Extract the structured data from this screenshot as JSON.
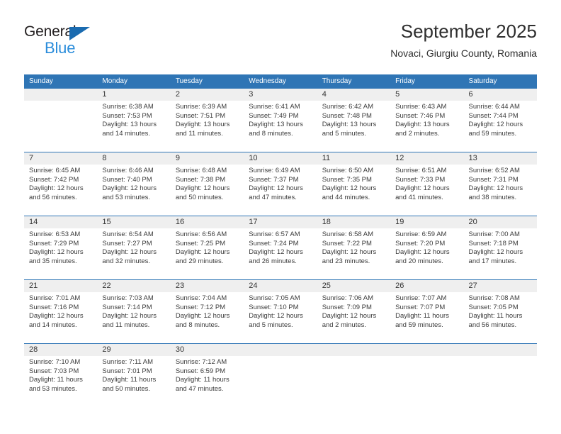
{
  "brand": {
    "name_part1": "General",
    "name_part2": "Blue",
    "colors": {
      "dark": "#231f20",
      "blue": "#2b8ddb",
      "triangle": "#1a6bb0"
    }
  },
  "header": {
    "title": "September 2025",
    "subtitle": "Novaci, Giurgiu County, Romania"
  },
  "theme": {
    "header_bg": "#2f75b5",
    "daynum_bg": "#efefef",
    "text": "#3b3b3b"
  },
  "weekdays": [
    "Sunday",
    "Monday",
    "Tuesday",
    "Wednesday",
    "Thursday",
    "Friday",
    "Saturday"
  ],
  "weeks": [
    {
      "days": [
        {
          "num": "",
          "lines": [
            "",
            "",
            "",
            ""
          ]
        },
        {
          "num": "1",
          "lines": [
            "Sunrise: 6:38 AM",
            "Sunset: 7:53 PM",
            "Daylight: 13 hours",
            "and 14 minutes."
          ]
        },
        {
          "num": "2",
          "lines": [
            "Sunrise: 6:39 AM",
            "Sunset: 7:51 PM",
            "Daylight: 13 hours",
            "and 11 minutes."
          ]
        },
        {
          "num": "3",
          "lines": [
            "Sunrise: 6:41 AM",
            "Sunset: 7:49 PM",
            "Daylight: 13 hours",
            "and 8 minutes."
          ]
        },
        {
          "num": "4",
          "lines": [
            "Sunrise: 6:42 AM",
            "Sunset: 7:48 PM",
            "Daylight: 13 hours",
            "and 5 minutes."
          ]
        },
        {
          "num": "5",
          "lines": [
            "Sunrise: 6:43 AM",
            "Sunset: 7:46 PM",
            "Daylight: 13 hours",
            "and 2 minutes."
          ]
        },
        {
          "num": "6",
          "lines": [
            "Sunrise: 6:44 AM",
            "Sunset: 7:44 PM",
            "Daylight: 12 hours",
            "and 59 minutes."
          ]
        }
      ]
    },
    {
      "days": [
        {
          "num": "7",
          "lines": [
            "Sunrise: 6:45 AM",
            "Sunset: 7:42 PM",
            "Daylight: 12 hours",
            "and 56 minutes."
          ]
        },
        {
          "num": "8",
          "lines": [
            "Sunrise: 6:46 AM",
            "Sunset: 7:40 PM",
            "Daylight: 12 hours",
            "and 53 minutes."
          ]
        },
        {
          "num": "9",
          "lines": [
            "Sunrise: 6:48 AM",
            "Sunset: 7:38 PM",
            "Daylight: 12 hours",
            "and 50 minutes."
          ]
        },
        {
          "num": "10",
          "lines": [
            "Sunrise: 6:49 AM",
            "Sunset: 7:37 PM",
            "Daylight: 12 hours",
            "and 47 minutes."
          ]
        },
        {
          "num": "11",
          "lines": [
            "Sunrise: 6:50 AM",
            "Sunset: 7:35 PM",
            "Daylight: 12 hours",
            "and 44 minutes."
          ]
        },
        {
          "num": "12",
          "lines": [
            "Sunrise: 6:51 AM",
            "Sunset: 7:33 PM",
            "Daylight: 12 hours",
            "and 41 minutes."
          ]
        },
        {
          "num": "13",
          "lines": [
            "Sunrise: 6:52 AM",
            "Sunset: 7:31 PM",
            "Daylight: 12 hours",
            "and 38 minutes."
          ]
        }
      ]
    },
    {
      "days": [
        {
          "num": "14",
          "lines": [
            "Sunrise: 6:53 AM",
            "Sunset: 7:29 PM",
            "Daylight: 12 hours",
            "and 35 minutes."
          ]
        },
        {
          "num": "15",
          "lines": [
            "Sunrise: 6:54 AM",
            "Sunset: 7:27 PM",
            "Daylight: 12 hours",
            "and 32 minutes."
          ]
        },
        {
          "num": "16",
          "lines": [
            "Sunrise: 6:56 AM",
            "Sunset: 7:25 PM",
            "Daylight: 12 hours",
            "and 29 minutes."
          ]
        },
        {
          "num": "17",
          "lines": [
            "Sunrise: 6:57 AM",
            "Sunset: 7:24 PM",
            "Daylight: 12 hours",
            "and 26 minutes."
          ]
        },
        {
          "num": "18",
          "lines": [
            "Sunrise: 6:58 AM",
            "Sunset: 7:22 PM",
            "Daylight: 12 hours",
            "and 23 minutes."
          ]
        },
        {
          "num": "19",
          "lines": [
            "Sunrise: 6:59 AM",
            "Sunset: 7:20 PM",
            "Daylight: 12 hours",
            "and 20 minutes."
          ]
        },
        {
          "num": "20",
          "lines": [
            "Sunrise: 7:00 AM",
            "Sunset: 7:18 PM",
            "Daylight: 12 hours",
            "and 17 minutes."
          ]
        }
      ]
    },
    {
      "days": [
        {
          "num": "21",
          "lines": [
            "Sunrise: 7:01 AM",
            "Sunset: 7:16 PM",
            "Daylight: 12 hours",
            "and 14 minutes."
          ]
        },
        {
          "num": "22",
          "lines": [
            "Sunrise: 7:03 AM",
            "Sunset: 7:14 PM",
            "Daylight: 12 hours",
            "and 11 minutes."
          ]
        },
        {
          "num": "23",
          "lines": [
            "Sunrise: 7:04 AM",
            "Sunset: 7:12 PM",
            "Daylight: 12 hours",
            "and 8 minutes."
          ]
        },
        {
          "num": "24",
          "lines": [
            "Sunrise: 7:05 AM",
            "Sunset: 7:10 PM",
            "Daylight: 12 hours",
            "and 5 minutes."
          ]
        },
        {
          "num": "25",
          "lines": [
            "Sunrise: 7:06 AM",
            "Sunset: 7:09 PM",
            "Daylight: 12 hours",
            "and 2 minutes."
          ]
        },
        {
          "num": "26",
          "lines": [
            "Sunrise: 7:07 AM",
            "Sunset: 7:07 PM",
            "Daylight: 11 hours",
            "and 59 minutes."
          ]
        },
        {
          "num": "27",
          "lines": [
            "Sunrise: 7:08 AM",
            "Sunset: 7:05 PM",
            "Daylight: 11 hours",
            "and 56 minutes."
          ]
        }
      ]
    },
    {
      "days": [
        {
          "num": "28",
          "lines": [
            "Sunrise: 7:10 AM",
            "Sunset: 7:03 PM",
            "Daylight: 11 hours",
            "and 53 minutes."
          ]
        },
        {
          "num": "29",
          "lines": [
            "Sunrise: 7:11 AM",
            "Sunset: 7:01 PM",
            "Daylight: 11 hours",
            "and 50 minutes."
          ]
        },
        {
          "num": "30",
          "lines": [
            "Sunrise: 7:12 AM",
            "Sunset: 6:59 PM",
            "Daylight: 11 hours",
            "and 47 minutes."
          ]
        },
        {
          "num": "",
          "lines": [
            "",
            "",
            "",
            ""
          ]
        },
        {
          "num": "",
          "lines": [
            "",
            "",
            "",
            ""
          ]
        },
        {
          "num": "",
          "lines": [
            "",
            "",
            "",
            ""
          ]
        },
        {
          "num": "",
          "lines": [
            "",
            "",
            "",
            ""
          ]
        }
      ]
    }
  ]
}
